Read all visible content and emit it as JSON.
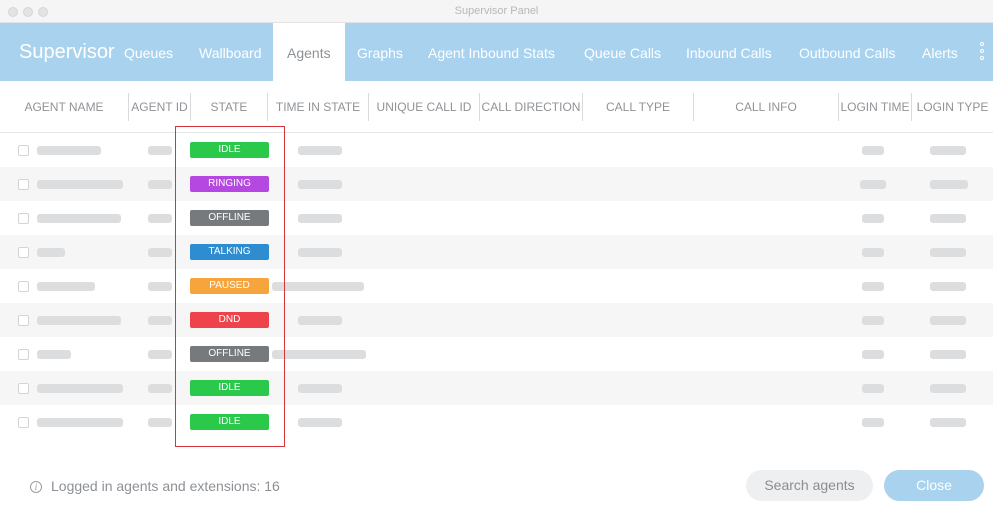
{
  "window": {
    "title": "Supervisor Panel"
  },
  "nav": {
    "brand": "Supervisor",
    "tabs": [
      {
        "label": "Queues"
      },
      {
        "label": "Wallboard"
      },
      {
        "label": "Agents",
        "active": true
      },
      {
        "label": "Graphs"
      },
      {
        "label": "Agent Inbound Stats"
      },
      {
        "label": "Queue Calls"
      },
      {
        "label": "Inbound Calls"
      },
      {
        "label": "Outbound Calls"
      },
      {
        "label": "Alerts"
      }
    ],
    "more_icon": "vertical-ellipsis-icon"
  },
  "table": {
    "columns": [
      "AGENT NAME",
      "AGENT ID",
      "STATE",
      "TIME IN STATE",
      "UNIQUE CALL ID",
      "CALL DIRECTION",
      "CALL TYPE",
      "CALL INFO",
      "LOGIN TIME",
      "LOGIN TYPE"
    ],
    "rows": [
      {
        "state": "IDLE",
        "state_kind": "idle"
      },
      {
        "state": "RINGING",
        "state_kind": "ringing"
      },
      {
        "state": "OFFLINE",
        "state_kind": "offline"
      },
      {
        "state": "TALKING",
        "state_kind": "talking"
      },
      {
        "state": "PAUSED",
        "state_kind": "paused"
      },
      {
        "state": "DND",
        "state_kind": "dnd"
      },
      {
        "state": "OFFLINE",
        "state_kind": "offline"
      },
      {
        "state": "IDLE",
        "state_kind": "idle"
      },
      {
        "state": "IDLE",
        "state_kind": "idle"
      }
    ],
    "state_colors": {
      "idle": "#2ac84b",
      "ringing": "#b448e0",
      "offline": "#777a7d",
      "talking": "#2e8cd0",
      "paused": "#f6a53c",
      "dnd": "#ee434b"
    },
    "note": "Agent names, IDs, times, login time and login type values are blurred in the screenshot."
  },
  "footer": {
    "info_icon": "info-circle-icon",
    "info_text": "Logged in agents and extensions: 16",
    "search_button": "Search agents",
    "close_button": "Close"
  },
  "colors": {
    "nav_background": "#a9d2ee",
    "highlight_box": "#d9343b"
  }
}
